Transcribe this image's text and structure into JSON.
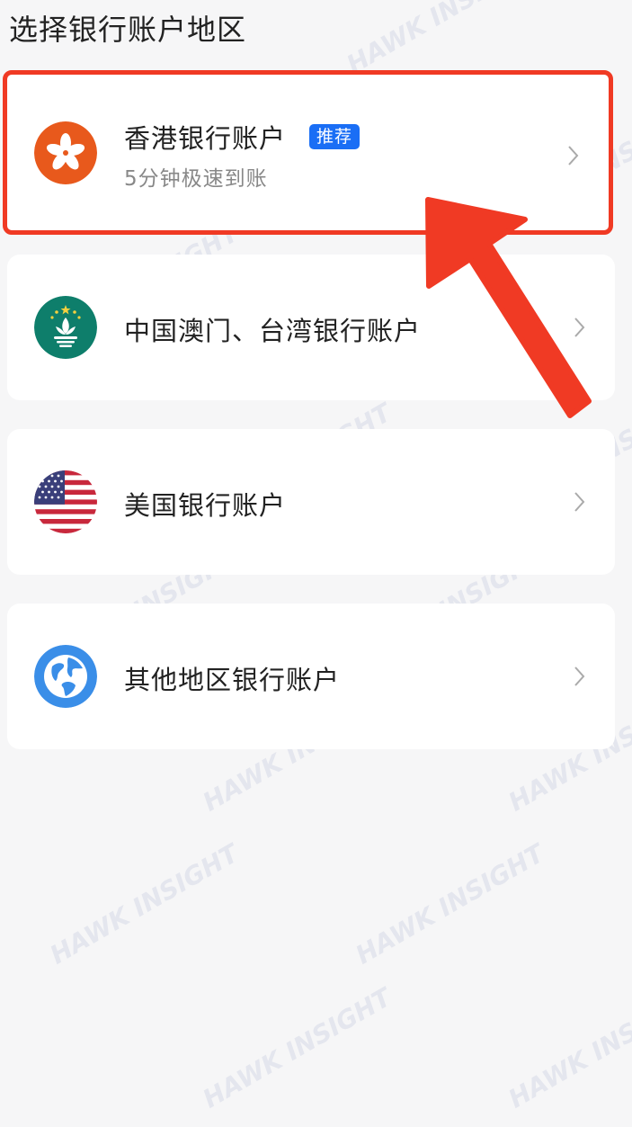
{
  "page": {
    "title": "选择银行账户地区"
  },
  "accounts": [
    {
      "title": "香港银行账户",
      "badge": "推荐",
      "subtitle": "5分钟极速到账",
      "flag_icon": "hong-kong-flag-icon"
    },
    {
      "title": "中国澳门、台湾银行账户",
      "flag_icon": "macau-flag-icon"
    },
    {
      "title": "美国银行账户",
      "flag_icon": "us-flag-icon"
    },
    {
      "title": "其他地区银行账户",
      "flag_icon": "globe-icon"
    }
  ],
  "watermark": {
    "text": "HAWK INSIGHT"
  },
  "colors": {
    "highlight_border": "#f03a24",
    "badge_bg": "#1a6ef5",
    "arrow": "#f03a24",
    "hk_flag": "#e8591c",
    "macau_flag": "#0e7e6b",
    "globe": "#3a8ee8"
  }
}
